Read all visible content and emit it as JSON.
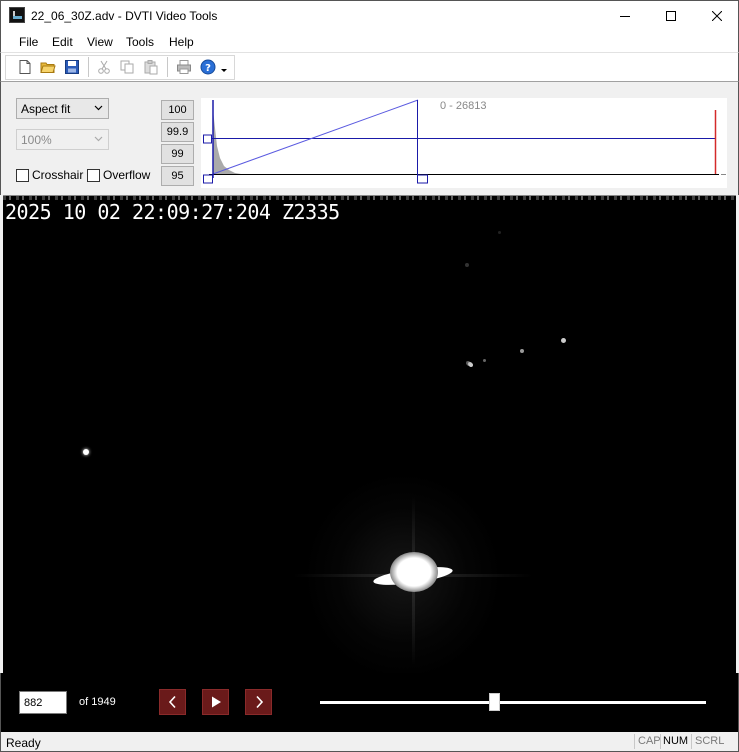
{
  "window": {
    "title": "22_06_30Z.adv - DVTI Video Tools",
    "icon": "dvti-app-icon"
  },
  "menu": [
    "File",
    "Edit",
    "View",
    "Tools",
    "Help"
  ],
  "toolbar": {
    "icons": [
      "new-file-icon",
      "open-folder-icon",
      "save-icon",
      "cut-icon",
      "copy-icon",
      "paste-icon",
      "print-icon",
      "help-icon"
    ]
  },
  "controls": {
    "fit_mode": "Aspect fit",
    "zoom": "100%",
    "crosshair_label": "Crosshair",
    "crosshair_checked": false,
    "overflow_label": "Overflow",
    "overflow_checked": false,
    "percentile_buttons": [
      "100",
      "99.9",
      "99",
      "95"
    ]
  },
  "histogram": {
    "range_label": "0 - 26813",
    "range_min": 0,
    "range_max": 26813
  },
  "video": {
    "timestamp": "2025 10 02 22:09:27:204 Z2335"
  },
  "navigation": {
    "frame": "882",
    "total": "of 1949",
    "current_frame": 882,
    "total_frames": 1949
  },
  "status": {
    "text": "Ready",
    "indicators": [
      {
        "label": "CAP",
        "active": false
      },
      {
        "label": "NUM",
        "active": true
      },
      {
        "label": "SCRL",
        "active": false
      }
    ]
  }
}
